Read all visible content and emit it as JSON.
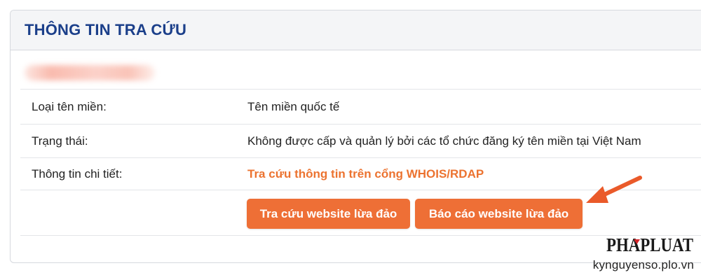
{
  "panel": {
    "title": "THÔNG TIN TRA CỨU"
  },
  "rows": [
    {
      "label": "Loại tên miền:",
      "value": "Tên miền quốc tế"
    },
    {
      "label": "Trạng thái:",
      "value": "Không được cấp và quản lý bởi các tổ chức đăng ký tên miền tại Việt Nam"
    },
    {
      "label": "Thông tin chi tiết:",
      "link": "Tra cứu thông tin trên cổng WHOIS/RDAP"
    }
  ],
  "actions": {
    "search_label": "Tra cứu website lừa đảo",
    "report_label": "Báo cáo website lừa đảo"
  },
  "watermark": {
    "logo": "PHAPLUAT",
    "site": "kynguyenso.plo.vn"
  },
  "colors": {
    "title": "#1b3f8a",
    "accent": "#ee6f36",
    "link": "#ec7330",
    "arrow": "#ea5a2a"
  },
  "icons": {
    "pointer": "arrow-icon"
  }
}
